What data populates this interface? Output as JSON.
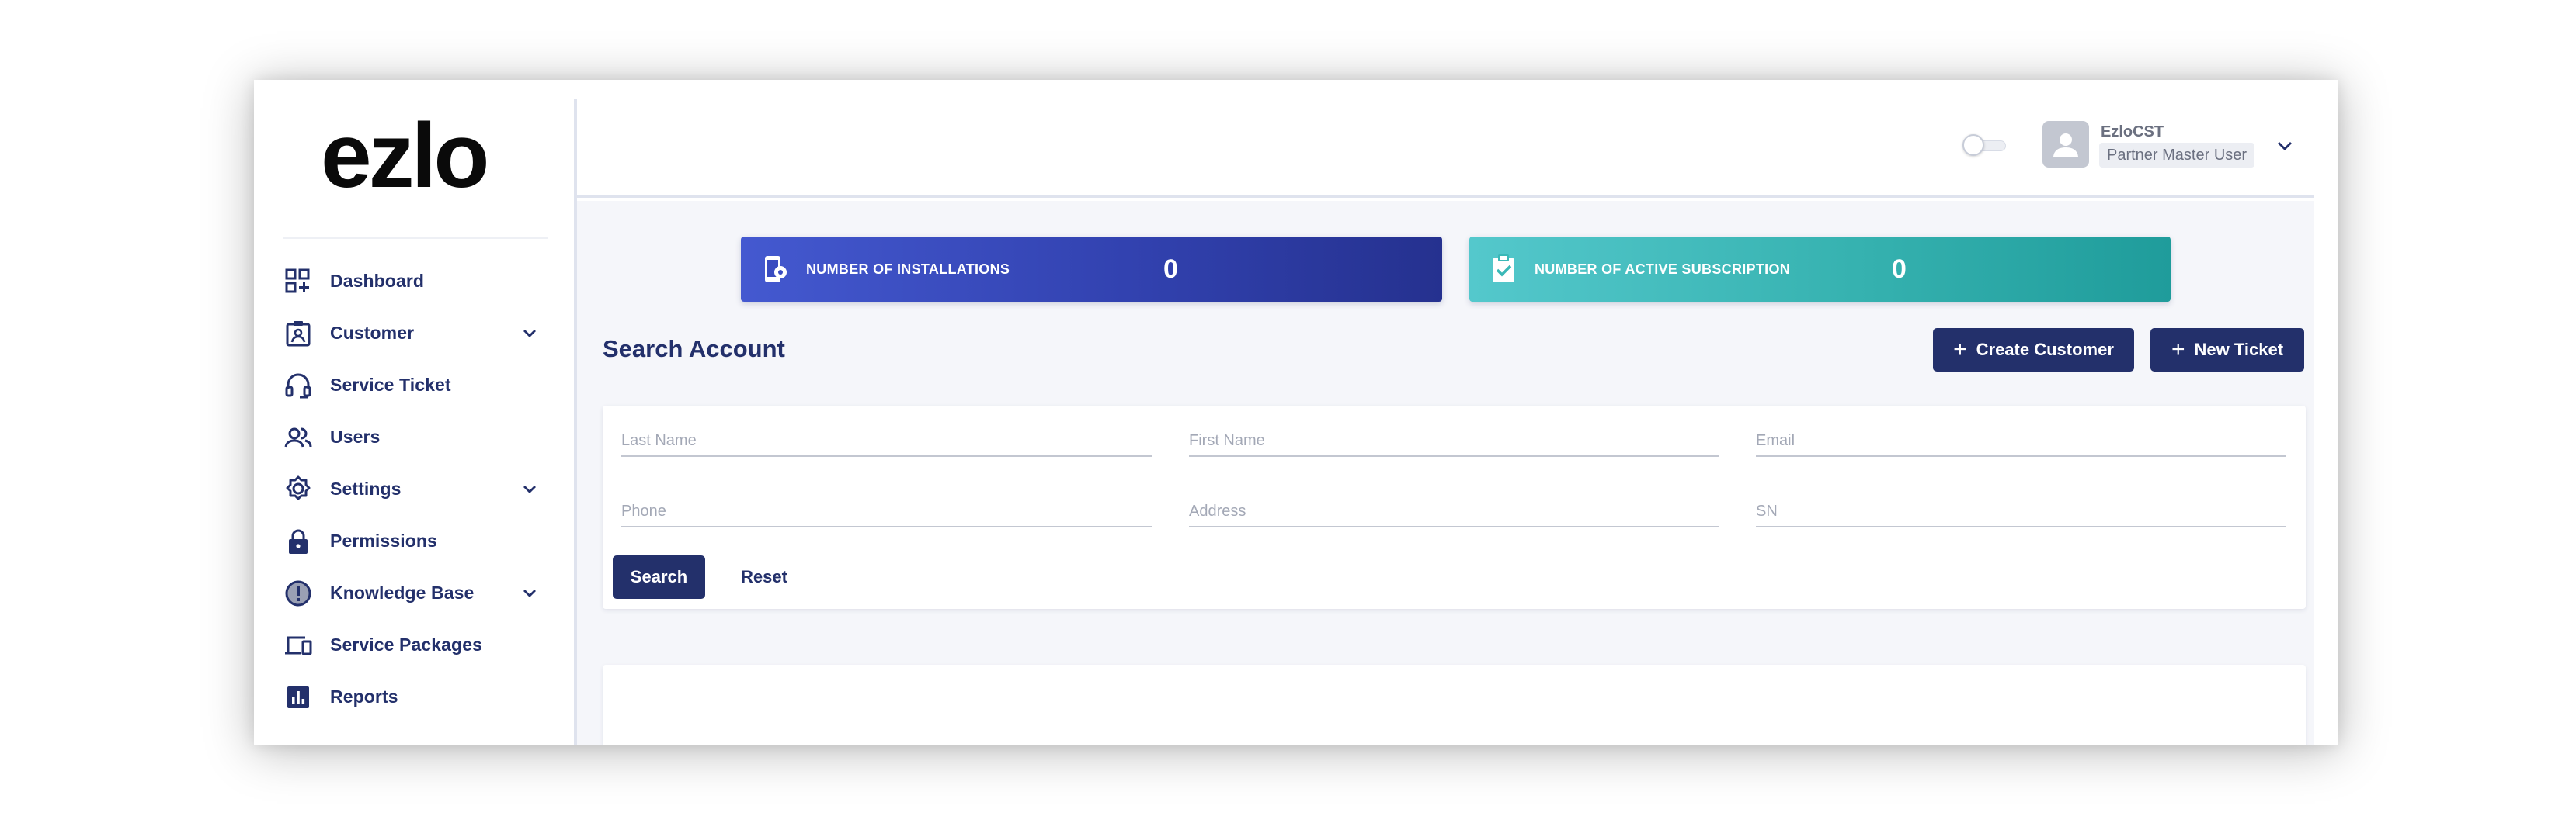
{
  "brand": {
    "logo_text": "ezlo"
  },
  "sidebar": {
    "items": [
      {
        "label": "Dashboard",
        "icon": "dashboard-icon",
        "expandable": false
      },
      {
        "label": "Customer",
        "icon": "customer-icon",
        "expandable": true
      },
      {
        "label": "Service Ticket",
        "icon": "headset-icon",
        "expandable": false
      },
      {
        "label": "Users",
        "icon": "users-icon",
        "expandable": false
      },
      {
        "label": "Settings",
        "icon": "gear-icon",
        "expandable": true
      },
      {
        "label": "Permissions",
        "icon": "lock-icon",
        "expandable": false
      },
      {
        "label": "Knowledge Base",
        "icon": "info-icon",
        "expandable": true
      },
      {
        "label": "Service Packages",
        "icon": "devices-icon",
        "expandable": false
      },
      {
        "label": "Reports",
        "icon": "reports-icon",
        "expandable": false
      }
    ]
  },
  "header": {
    "user_name": "EzloCST",
    "user_role": "Partner Master User",
    "theme_toggle_on": false
  },
  "stats": {
    "installations": {
      "label": "NUMBER OF INSTALLATIONS",
      "value": "0",
      "icon": "phone-gear-icon"
    },
    "subscriptions": {
      "label": "NUMBER OF ACTIVE SUBSCRIPTION",
      "value": "0",
      "icon": "clipboard-check-icon"
    }
  },
  "search": {
    "title": "Search Account",
    "create_customer_label": "Create Customer",
    "new_ticket_label": "New Ticket",
    "fields": {
      "last_name": {
        "placeholder": "Last Name",
        "value": ""
      },
      "first_name": {
        "placeholder": "First Name",
        "value": ""
      },
      "email": {
        "placeholder": "Email",
        "value": ""
      },
      "phone": {
        "placeholder": "Phone",
        "value": ""
      },
      "address": {
        "placeholder": "Address",
        "value": ""
      },
      "sn": {
        "placeholder": "SN",
        "value": ""
      }
    },
    "search_label": "Search",
    "reset_label": "Reset"
  },
  "colors": {
    "primary": "#23306b",
    "installations_gradient": [
      "#4459d0",
      "#25318f"
    ],
    "subscriptions_gradient": [
      "#54c8cc",
      "#1f9c9b"
    ],
    "page_background": "#f5f6fa"
  }
}
